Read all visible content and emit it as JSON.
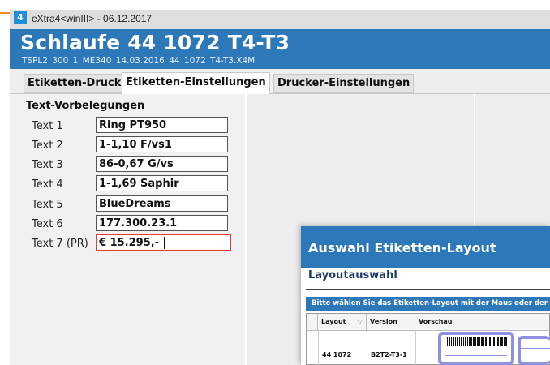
{
  "window": {
    "title": "eXtra4<winIII> - 06.12.2017",
    "app_icon_glyph": "4"
  },
  "header": {
    "title": "Schlaufe 44 1072 T4-T3",
    "subtitle": "TSPL2   300 1   ME340  14.03.2016  44 1072 T4-T3.X4M"
  },
  "tabs": [
    {
      "label": "Etiketten-Druck"
    },
    {
      "label": "Etiketten-Einstellungen"
    },
    {
      "label": "Drucker-Einstellungen"
    }
  ],
  "text_defaults": {
    "title": "Text-Vorbelegungen",
    "fields": [
      {
        "label": "Text 1",
        "value": "Ring PT950"
      },
      {
        "label": "Text 2",
        "value": "1-1,10 F/vs1"
      },
      {
        "label": "Text 3",
        "value": "86-0,67 G/vs"
      },
      {
        "label": "Text 4",
        "value": "1-1,69 Saphir"
      },
      {
        "label": "Text 5",
        "value": "BlueDreams"
      },
      {
        "label": "Text 6",
        "value": "177.300.23.1"
      },
      {
        "label": "Text 7 (PR)",
        "value": "€  15.295,-"
      }
    ]
  },
  "dialog": {
    "title": "Auswahl Etiketten-Layout",
    "subtitle": "Layoutauswahl",
    "hint": "Bitte wählen Sie das Etiketten-Layout mit der Maus oder der",
    "columns": [
      "Layout",
      "Version",
      "Vorschau"
    ],
    "rows": [
      {
        "layout": "44 1072",
        "version": "B2T2-T3-1"
      }
    ]
  },
  "colors": {
    "accent_blue": "#2d78b9",
    "active_field_border": "#e53b3b",
    "accent_orange": "#f08a24"
  }
}
